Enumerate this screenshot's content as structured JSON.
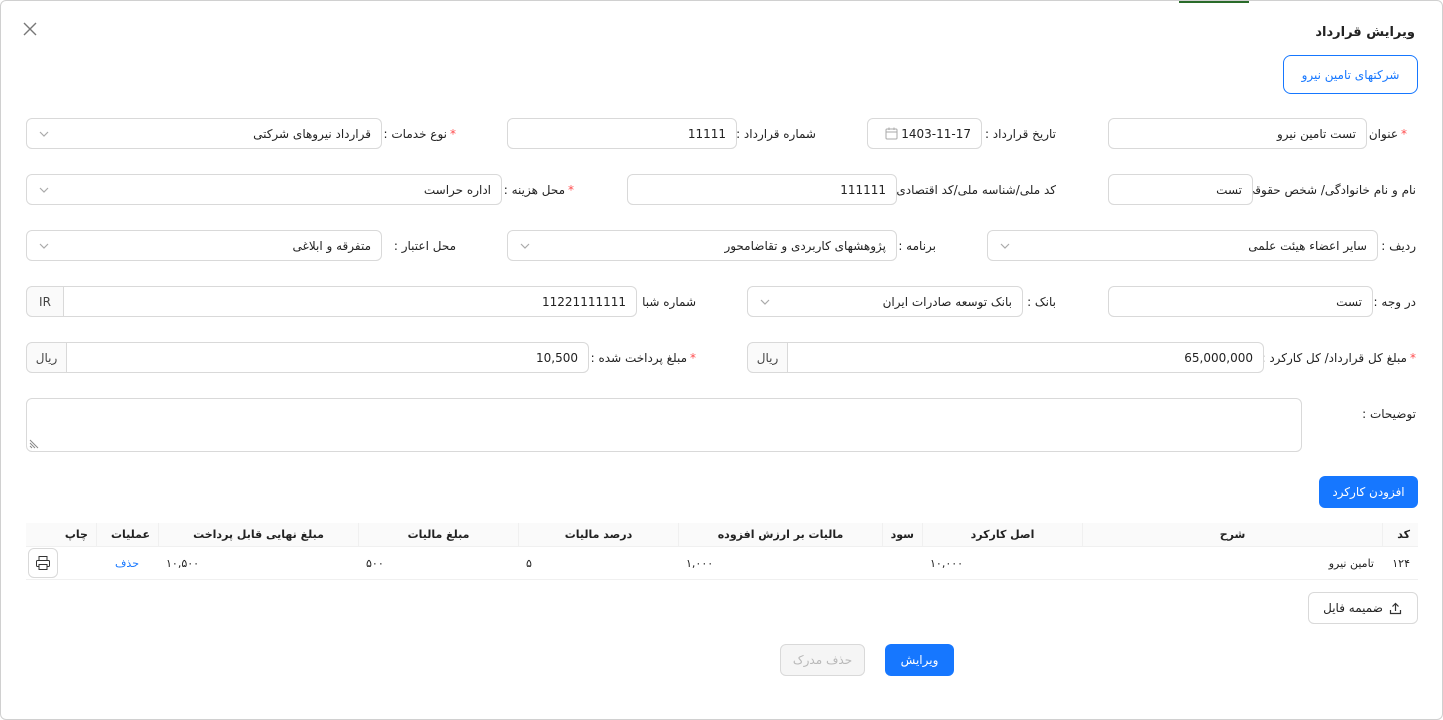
{
  "title": "ویرایش قرارداد",
  "buttons": {
    "companies": "شرکتهای تامین نیرو",
    "add_work": "افزودن کارکرد",
    "attach_file": "ضمیمه فایل",
    "edit": "ویرایش",
    "delete_doc": "حذف مدرک"
  },
  "form": {
    "subject": {
      "label": "عنوان :",
      "value": "تست تامین نیرو",
      "required": true
    },
    "contract_date": {
      "label": "تاریخ قرارداد :",
      "value": "1403-11-17"
    },
    "contract_number": {
      "label": "شماره قرارداد :",
      "value": "11111"
    },
    "service_type": {
      "label": "نوع خدمات :",
      "value": "قرارداد نیروهای شرکتی",
      "required": true
    },
    "party_name": {
      "label": "نام و نام خانوادگی/ شخص حقوقی :",
      "value": "تست"
    },
    "national_id": {
      "label": "کد ملی/شناسه ملی/کد اقتصادی :",
      "value": "111111"
    },
    "cost_center": {
      "label": "محل هزینه :",
      "value": "اداره حراست",
      "required": true
    },
    "row": {
      "label": "ردیف :",
      "value": "سایر اعضاء هیئت علمی"
    },
    "program": {
      "label": "برنامه :",
      "value": "پژوهشهای کاربردی و تقاضامحور"
    },
    "credit_source": {
      "label": "محل اعتبار :",
      "value": "متفرقه و ابلاغی"
    },
    "payee": {
      "label": "در وجه :",
      "value": "تست"
    },
    "bank": {
      "label": "بانک :",
      "value": "بانک توسعه صادرات ایران"
    },
    "sheba": {
      "label": "شماره شبا :",
      "value": "11221111111",
      "prefix": "IR"
    },
    "total_amount": {
      "label": "مبلغ کل قرارداد/ کل کارکرد :",
      "value": "65,000,000",
      "unit": "ریال",
      "required": true
    },
    "paid_amount": {
      "label": "مبلغ پرداخت شده :",
      "value": "10,500",
      "unit": "ریال",
      "required": true
    },
    "notes": {
      "label": "توضیحات :",
      "value": ""
    }
  },
  "table": {
    "columns": {
      "code": "کد",
      "desc": "شرح",
      "base": "اصل کارکرد",
      "profit": "سود",
      "vat": "مالیات بر ارزش افزوده",
      "tax_percent": "درصد مالیات",
      "tax_amount": "مبلغ مالیات",
      "final": "مبلغ نهایی قابل پرداخت",
      "ops": "عملیات",
      "print": "چاپ"
    },
    "rows": [
      {
        "code": "۱۲۴",
        "desc": "تامین نیرو",
        "base": "۱۰,۰۰۰",
        "profit": "",
        "vat": "۱,۰۰۰",
        "tax_percent": "۵",
        "tax_amount": "۵۰۰",
        "final": "۱۰,۵۰۰",
        "ops": "حذف"
      }
    ]
  },
  "icons": {
    "close": "close-icon",
    "chevron": "chevron-down-icon",
    "calendar": "calendar-icon",
    "upload": "upload-icon",
    "print": "printer-icon"
  },
  "colors": {
    "primary": "#1677ff",
    "required": "#ff4d4f"
  }
}
